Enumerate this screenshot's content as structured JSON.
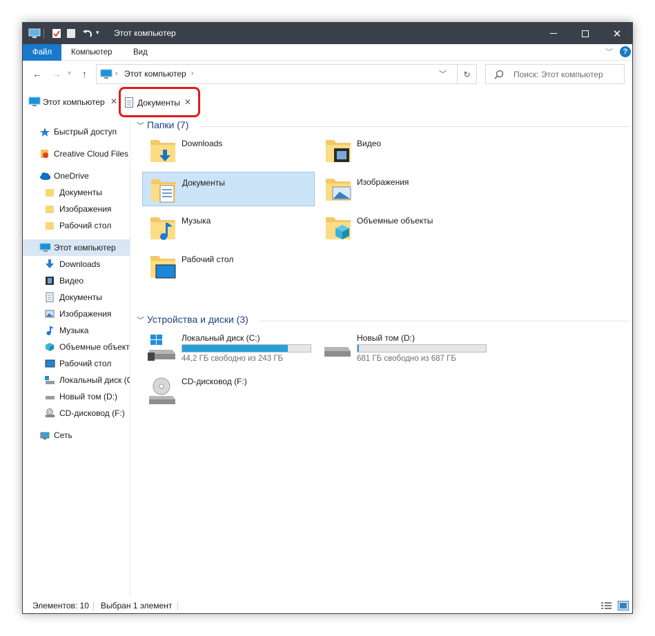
{
  "window": {
    "title": "Этот компьютер"
  },
  "ribbon": {
    "tabs": [
      "Файл",
      "Компьютер",
      "Вид"
    ]
  },
  "address": {
    "location": "Этот компьютер",
    "search_placeholder": "Поиск: Этот компьютер"
  },
  "tabs": [
    {
      "label": "Этот компьютер",
      "close": "✕"
    },
    {
      "label": "Документы",
      "close": "✕"
    }
  ],
  "sidebar": {
    "items": [
      {
        "label": "Быстрый доступ",
        "icon": "star-icon"
      },
      {
        "label": "Creative Cloud Files",
        "icon": "creative-cloud-icon"
      },
      {
        "label": "OneDrive",
        "icon": "cloud-icon"
      },
      {
        "label": "Документы",
        "icon": "folder-icon"
      },
      {
        "label": "Изображения",
        "icon": "folder-icon"
      },
      {
        "label": "Рабочий стол",
        "icon": "folder-icon"
      },
      {
        "label": "Этот компьютер",
        "icon": "computer-icon"
      },
      {
        "label": "Downloads",
        "icon": "download-icon"
      },
      {
        "label": "Видео",
        "icon": "film-icon"
      },
      {
        "label": "Документы",
        "icon": "document-icon"
      },
      {
        "label": "Изображения",
        "icon": "picture-icon"
      },
      {
        "label": "Музыка",
        "icon": "music-icon"
      },
      {
        "label": "Объемные объект",
        "icon": "cube-icon"
      },
      {
        "label": "Рабочий стол",
        "icon": "desktop-icon"
      },
      {
        "label": "Локальный диск (С",
        "icon": "drive-icon"
      },
      {
        "label": "Новый том (D:)",
        "icon": "drive-icon"
      },
      {
        "label": "CD-дисковод (F:)",
        "icon": "cd-icon"
      },
      {
        "label": "Сеть",
        "icon": "network-icon"
      }
    ]
  },
  "folders": {
    "header": "Папки (7)",
    "items": [
      {
        "name": "Downloads",
        "icon": "downloads-folder-icon"
      },
      {
        "name": "Видео",
        "icon": "video-folder-icon"
      },
      {
        "name": "Документы",
        "icon": "documents-folder-icon"
      },
      {
        "name": "Изображения",
        "icon": "pictures-folder-icon"
      },
      {
        "name": "Музыка",
        "icon": "music-folder-icon"
      },
      {
        "name": "Объемные объекты",
        "icon": "3d-objects-folder-icon"
      },
      {
        "name": "Рабочий стол",
        "icon": "desktop-folder-icon"
      }
    ]
  },
  "devices": {
    "header": "Устройства и диски (3)",
    "items": [
      {
        "name": "Локальный диск (C:)",
        "free": "44,2 ГБ свободно из 243 ГБ",
        "used_fraction": 0.818
      },
      {
        "name": "Новый том (D:)",
        "free": "681 ГБ свободно из 687 ГБ",
        "used_fraction": 0.009
      },
      {
        "name": "CD-дисковод (F:)"
      }
    ]
  },
  "status": {
    "count": "Элементов: 10",
    "selected": "Выбран 1 элемент"
  },
  "colors": {
    "titlebar": "#3a404a",
    "accent": "#1979ca",
    "selection": "#cce4f7",
    "highlight": "#e01a1a",
    "drive_bar": "#26a0da"
  }
}
